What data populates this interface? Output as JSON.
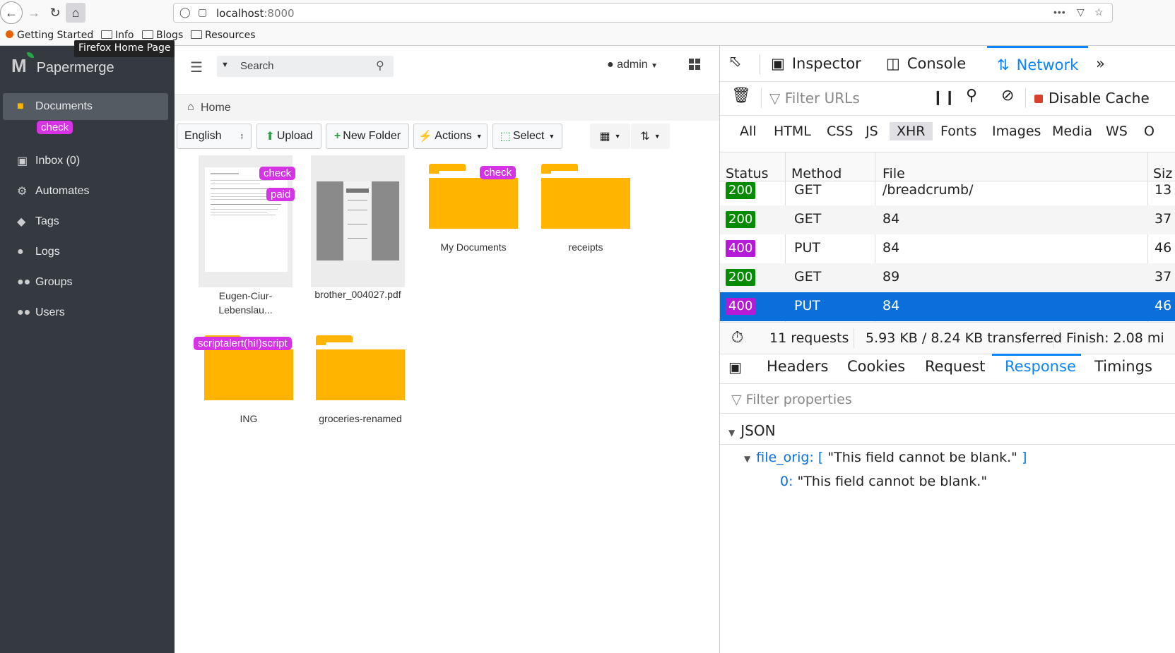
{
  "browser": {
    "url_host": "localhost",
    "url_port": ":8000",
    "bookmarks": [
      "Getting Started",
      "Info",
      "Blogs",
      "Resources"
    ],
    "tooltip": "Firefox Home Page",
    "more_icon": "•••"
  },
  "app": {
    "name": "Papermerge",
    "search_placeholder": "Search",
    "user": "admin",
    "sidebar": [
      {
        "label": "Documents",
        "icon": "folder-icon"
      },
      {
        "label": "Inbox (0)",
        "icon": "inbox-icon"
      },
      {
        "label": "Automates",
        "icon": "robot-icon"
      },
      {
        "label": "Tags",
        "icon": "tag-icon"
      },
      {
        "label": "Logs",
        "icon": "bulb-icon"
      },
      {
        "label": "Groups",
        "icon": "group-icon"
      },
      {
        "label": "Users",
        "icon": "users-icon"
      }
    ],
    "sidebar_tag": "check",
    "breadcrumb": "Home",
    "toolbar": {
      "language": "English",
      "upload": "Upload",
      "new_folder": "New Folder",
      "actions": "Actions",
      "select": "Select"
    },
    "items": [
      {
        "name_line1": "Eugen-Ciur-",
        "name_line2": "Lebenslau...",
        "tags": [
          "check",
          "paid"
        ]
      },
      {
        "name": "brother_004027.pdf"
      },
      {
        "name": "My Documents",
        "tags": [
          "check"
        ]
      },
      {
        "name": "receipts"
      },
      {
        "name": "ING",
        "tags": [
          "scriptalert(hi!)script"
        ]
      },
      {
        "name": "groceries-renamed"
      }
    ],
    "tag_color": "#d633e6",
    "folder_color": "#ffb400"
  },
  "devtools": {
    "tabs": [
      "Inspector",
      "Console",
      "Network"
    ],
    "filter_placeholder": "Filter URLs",
    "disable_cache": "Disable Cache",
    "types": [
      "All",
      "HTML",
      "CSS",
      "JS",
      "XHR",
      "Fonts",
      "Images",
      "Media",
      "WS",
      "O"
    ],
    "columns": [
      "Status",
      "Method",
      "File",
      "Siz"
    ],
    "rows": [
      {
        "status": "200",
        "method": "GET",
        "file": "/breadcrumb/",
        "size": "13"
      },
      {
        "status": "200",
        "method": "GET",
        "file": "84",
        "size": "37"
      },
      {
        "status": "400",
        "method": "PUT",
        "file": "84",
        "size": "46"
      },
      {
        "status": "200",
        "method": "GET",
        "file": "89",
        "size": "37"
      },
      {
        "status": "400",
        "method": "PUT",
        "file": "84",
        "size": "46"
      }
    ],
    "summary": {
      "requests": "11 requests",
      "transferred": "5.93 KB / 8.24 KB transferred",
      "finish": "Finish: 2.08 mi"
    },
    "panel_tabs": [
      "Headers",
      "Cookies",
      "Request",
      "Response",
      "Timings"
    ],
    "filter_properties": "Filter properties",
    "json_label": "JSON",
    "json_key": "file_orig:",
    "json_value": "[ \"This field cannot be blank.\" ]",
    "json_index": "0:",
    "json_item": "\"This field cannot be blank.\"",
    "colors": {
      "ok": "#058b00",
      "error": "#b51ad6",
      "selected": "#0a6fdb",
      "accent": "#0a84ff"
    }
  }
}
